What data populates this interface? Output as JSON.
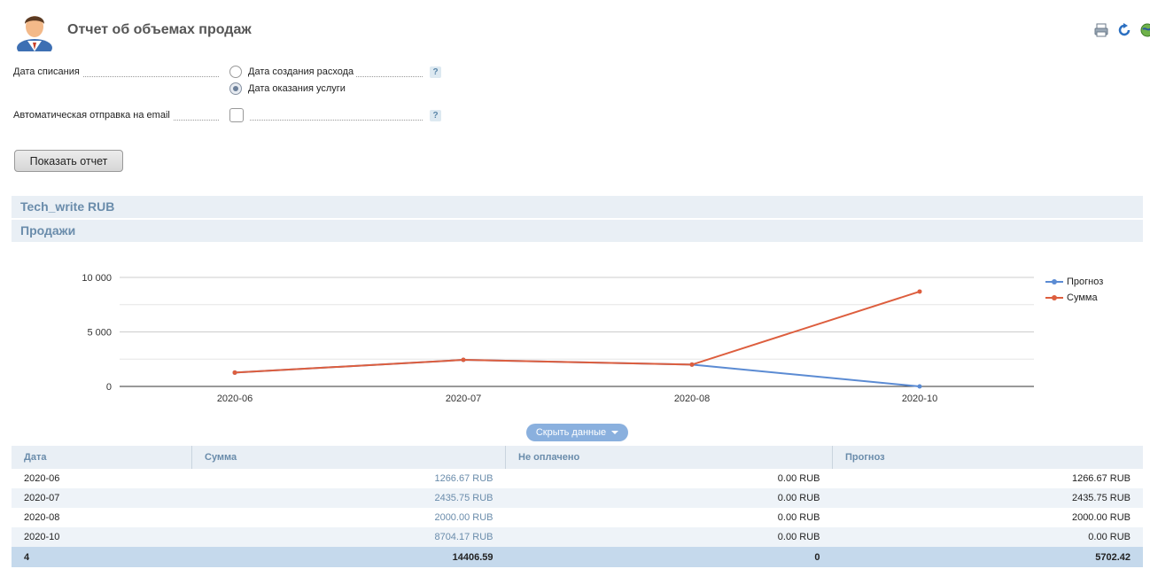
{
  "header": {
    "title": "Отчет об объемах продаж",
    "icons": [
      "user-avatar-icon",
      "print-icon",
      "refresh-icon",
      "globe-icon"
    ]
  },
  "form": {
    "write_off_label": "Дата списания",
    "option_expense": "Дата создания расхода",
    "option_service": "Дата оказания услуги",
    "selected": "Дата оказания услуги",
    "email_label": "Автоматическая отправка на email",
    "email_checked": false,
    "help": "?"
  },
  "buttons": {
    "show_report": "Показать отчет",
    "toggle_data": "Скрыть данные"
  },
  "sections": {
    "account": "Tech_write RUB",
    "sales": "Продажи"
  },
  "colors": {
    "forecast": "#5b8bd3",
    "sum": "#dd5e3e",
    "accent": "#6a8cab"
  },
  "chart_data": {
    "type": "line",
    "categories": [
      "2020-06",
      "2020-07",
      "2020-08",
      "2020-10"
    ],
    "series": [
      {
        "name": "Прогноз",
        "color": "#5b8bd3",
        "values": [
          1266.67,
          2435.75,
          2000.0,
          0.0
        ]
      },
      {
        "name": "Сумма",
        "color": "#dd5e3e",
        "values": [
          1266.67,
          2435.75,
          2000.0,
          8704.17
        ]
      }
    ],
    "yticks": [
      "10 000",
      "5 000",
      "0"
    ],
    "ylim": [
      0,
      10000
    ],
    "grid": true,
    "legend": "top-right"
  },
  "table": {
    "columns": [
      "Дата",
      "Сумма",
      "Не оплачено",
      "Прогноз"
    ],
    "rows": [
      [
        "2020-06",
        "1266.67 RUB",
        "0.00 RUB",
        "1266.67 RUB"
      ],
      [
        "2020-07",
        "2435.75 RUB",
        "0.00 RUB",
        "2435.75 RUB"
      ],
      [
        "2020-08",
        "2000.00 RUB",
        "0.00 RUB",
        "2000.00 RUB"
      ],
      [
        "2020-10",
        "8704.17 RUB",
        "0.00 RUB",
        "0.00 RUB"
      ]
    ],
    "total": [
      "4",
      "14406.59",
      "0",
      "5702.42"
    ]
  }
}
